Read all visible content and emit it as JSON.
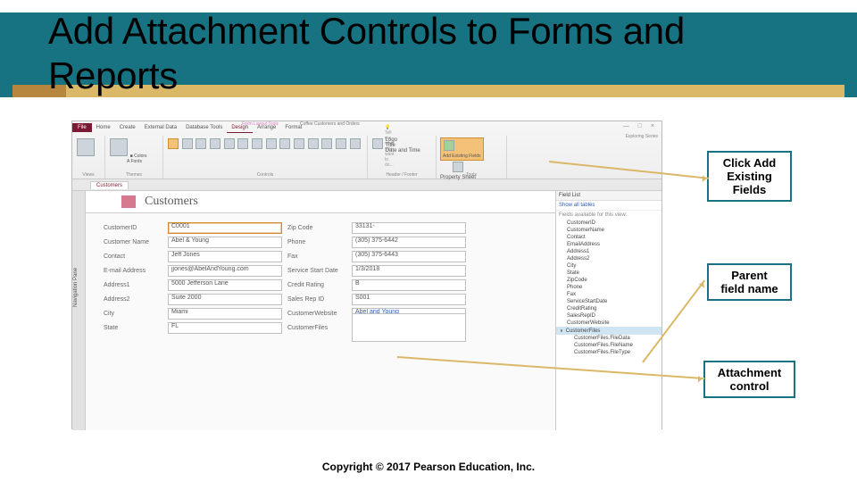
{
  "slide": {
    "title_line1": "Add Attachment Controls to Forms and",
    "title_line2": "Reports",
    "copyright": "Copyright © 2017 Pearson Education, Inc."
  },
  "callouts": {
    "c1_l1": "Click Add",
    "c1_l2": "Existing",
    "c1_l3": "Fields",
    "c2_l1": "Parent",
    "c2_l2": "field name",
    "c3_l1": "Attachment",
    "c3_l2": "control"
  },
  "ribbon": {
    "file": "File",
    "tabs": [
      "Home",
      "Create",
      "External Data",
      "Database Tools",
      "Design",
      "Arrange",
      "Format"
    ],
    "ctx_group1": "Form Layout Tools",
    "ctx_group2": "Coffee Customers and Orders",
    "tell_me": "Tell me what you want to do...",
    "exploring": "Exploring Series",
    "groups": {
      "views": "Views",
      "themes": "Themes",
      "controls": "Controls",
      "headerfooter": "Header / Footer",
      "tools": "Tools"
    },
    "hf_items": [
      "Logo",
      "Title",
      "Date and Time"
    ],
    "add_existing": "Add Existing Fields",
    "property": "Property Sheet",
    "theme_sub1": "Colors",
    "theme_sub2": "Fonts"
  },
  "doc": {
    "tab": "Customers",
    "nav": "Navigation Pane"
  },
  "form": {
    "header_title": "Customers",
    "labels": {
      "customerID": "CustomerID",
      "customerName": "Customer Name",
      "contact": "Contact",
      "email": "E-mail Address",
      "address1": "Address1",
      "address2": "Address2",
      "city": "City",
      "state": "State",
      "zip": "Zip Code",
      "phone": "Phone",
      "fax": "Fax",
      "serviceStart": "Service Start Date",
      "creditRating": "Credit Rating",
      "salesRep": "Sales Rep ID",
      "website": "CustomerWebsite",
      "files": "CustomerFiles"
    },
    "values": {
      "customerID": "C0001",
      "customerName": "Abel & Young",
      "contact": "Jeff Jones",
      "email": "jjones@AbelAndYoung.com",
      "address1": "5000 Jefferson Lane",
      "address2": "Suite 2000",
      "city": "Miami",
      "state": "FL",
      "zip": "33131-",
      "phone": "(305) 375-6442",
      "fax": "(305) 375-6443",
      "serviceStart": "1/3/2018",
      "creditRating": "B",
      "salesRep": "S001",
      "website": "Abel and Young",
      "files": ""
    }
  },
  "fieldList": {
    "header": "Field List",
    "show_all": "Show all tables",
    "available": "Fields available for this view:",
    "items": [
      "CustomerID",
      "CustomerName",
      "Contact",
      "EmailAddress",
      "Address1",
      "Address2",
      "City",
      "State",
      "ZipCode",
      "Phone",
      "Fax",
      "ServiceStartDate",
      "CreditRating",
      "SalesRepID",
      "CustomerWebsite"
    ],
    "parent": "CustomerFiles",
    "children": [
      "CustomerFiles.FileData",
      "CustomerFiles.FileName",
      "CustomerFiles.FileType"
    ]
  }
}
